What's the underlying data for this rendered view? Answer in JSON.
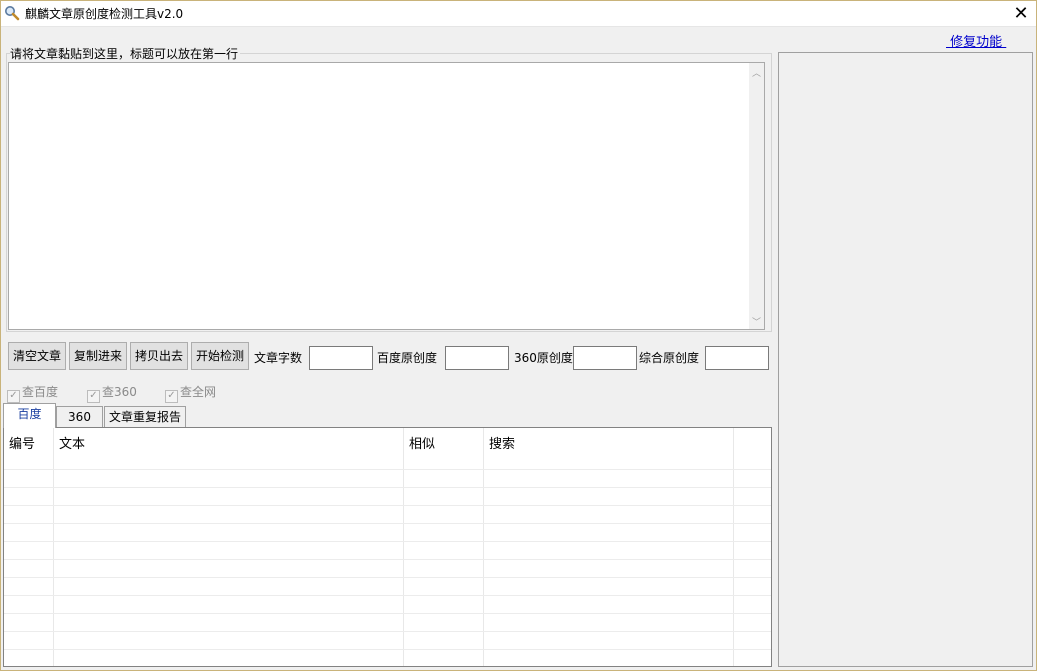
{
  "window": {
    "title": "麒麟文章原创度检测工具v2.0",
    "close_glyph": "✕"
  },
  "repair_link": " 修复功能 ",
  "article_group": {
    "label": "请将文章黏贴到这里，标题可以放在第一行",
    "content": ""
  },
  "toolbar": {
    "clear_label": "清空文章",
    "paste_label": "复制进来",
    "copy_out_label": "拷贝出去",
    "start_label": "开始检测",
    "word_count_label": "文章字数",
    "baidu_originality_label": "百度原创度",
    "s360_originality_label": "360原创度",
    "overall_originality_label": "综合原创度",
    "word_count_value": "",
    "baidu_originality_value": "",
    "s360_originality_value": "",
    "overall_originality_value": ""
  },
  "checks": {
    "baidu": {
      "label": "查百度",
      "checked": true
    },
    "s360": {
      "label": "查360",
      "checked": true
    },
    "web": {
      "label": "查全网",
      "checked": true
    }
  },
  "tabs": {
    "baidu": "百度",
    "s360": "360",
    "report": "文章重复报告"
  },
  "grid": {
    "col_id": "编号",
    "col_text": "文本",
    "col_similar": "相似",
    "col_search": "搜索"
  },
  "icons": {
    "app": "magnifier-icon",
    "check": "✓"
  },
  "colors": {
    "link": "#0000cc",
    "active_tab_text": "#1a3fa0",
    "window_border": "#c9b37a"
  }
}
